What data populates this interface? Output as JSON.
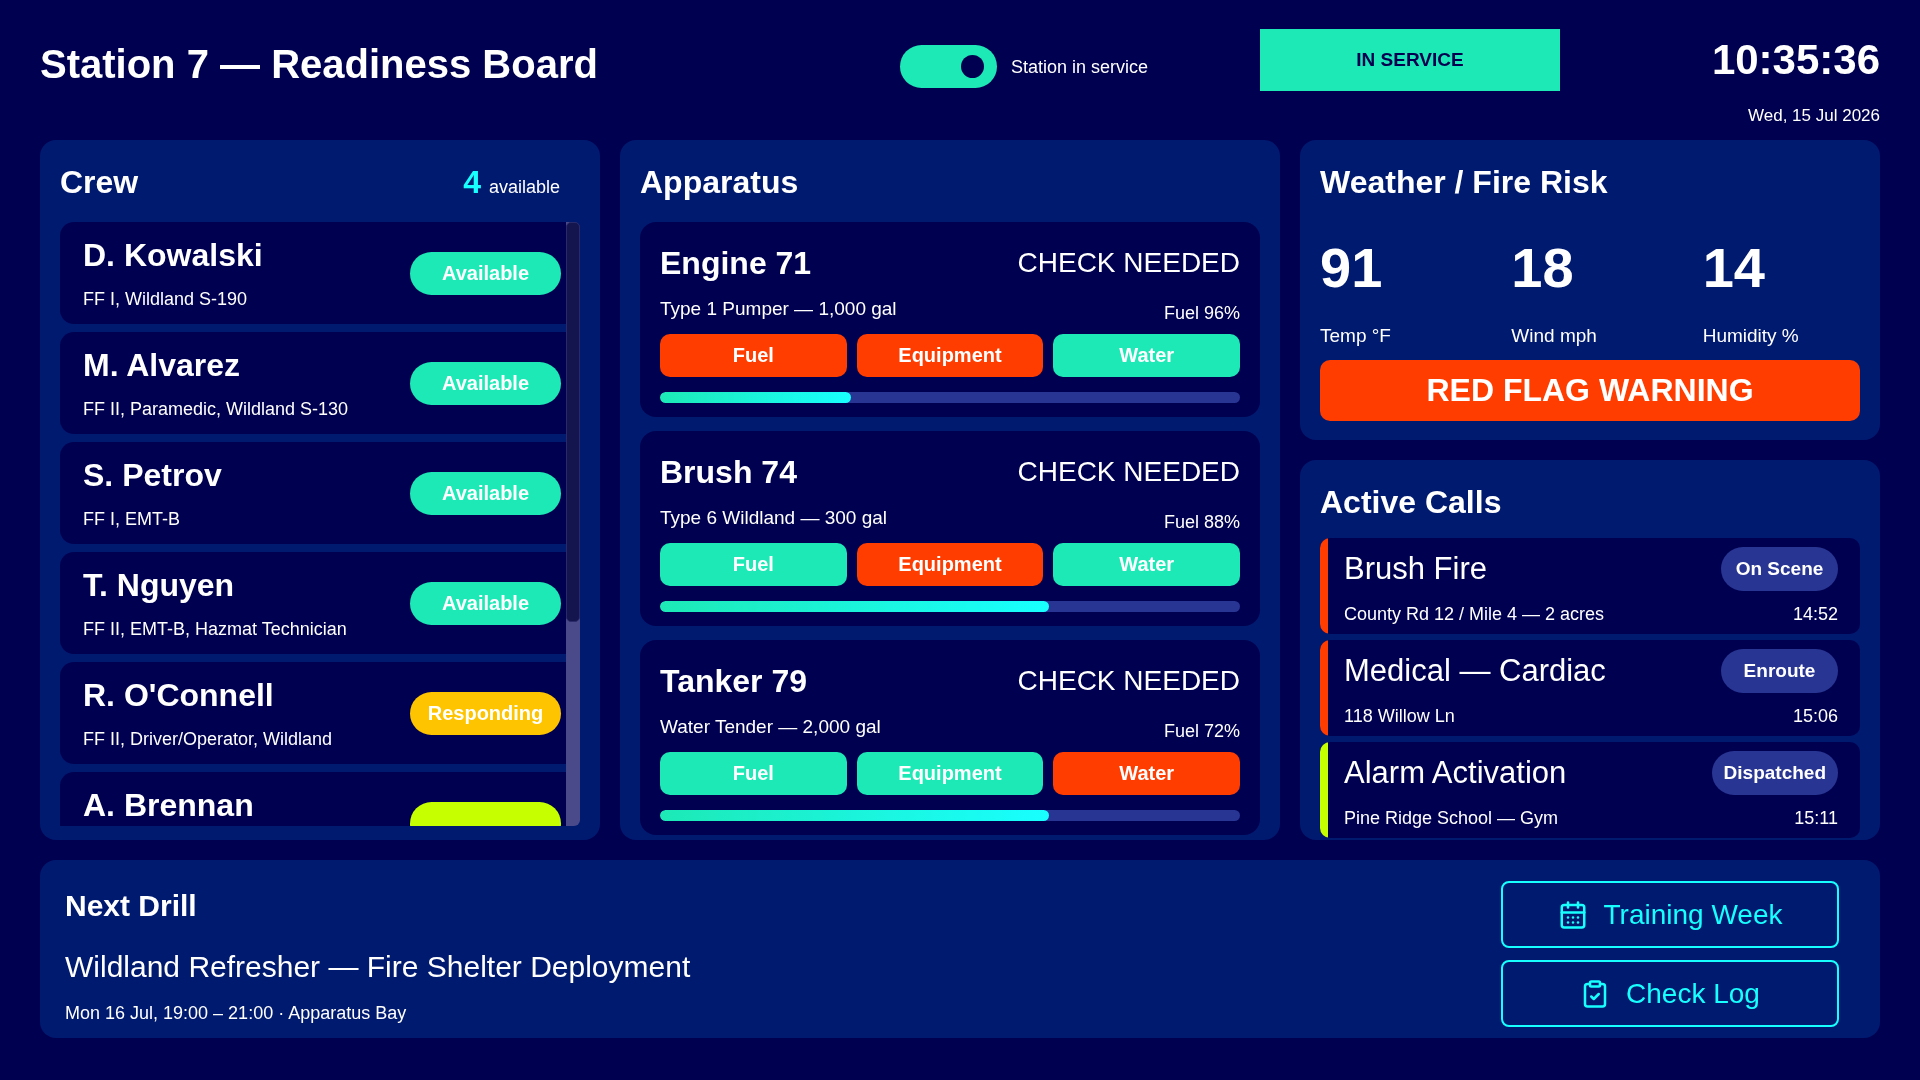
{
  "header": {
    "title": "Station 7 — Readiness Board",
    "service_toggle": {
      "label": "Station in service",
      "on": true
    },
    "status_banner": "IN SERVICE",
    "time": "10:35:36",
    "date": "Wed, 15 Jul 2026"
  },
  "crew": {
    "title": "Crew",
    "available_count": "4",
    "available_label": "available",
    "members": [
      {
        "name": "D. Kowalski",
        "qualifications": "FF I, Wildland S-190",
        "status": "Available",
        "color": "#1de9b6"
      },
      {
        "name": "M. Alvarez",
        "qualifications": "FF II, Paramedic, Wildland S-130",
        "status": "Available",
        "color": "#1de9b6"
      },
      {
        "name": "S. Petrov",
        "qualifications": "FF I, EMT-B",
        "status": "Available",
        "color": "#1de9b6"
      },
      {
        "name": "T. Nguyen",
        "qualifications": "FF II, EMT-B, Hazmat Technician",
        "status": "Available",
        "color": "#1de9b6"
      },
      {
        "name": "R. O'Connell",
        "qualifications": "FF II, Driver/Operator, Wildland",
        "status": "Responding",
        "color": "#ffc400"
      },
      {
        "name": "A. Brennan",
        "color": "#c6ff00"
      }
    ]
  },
  "apparatus": {
    "title": "Apparatus",
    "units": [
      {
        "name": "Engine 71",
        "status": "CHECK NEEDED",
        "description": "Type 1 Pumper — 1,000 gal",
        "fuel": "Fuel 96%",
        "checks": [
          {
            "label": "Fuel",
            "ok": false
          },
          {
            "label": "Equipment",
            "ok": false
          },
          {
            "label": "Water",
            "ok": true
          }
        ],
        "level": 0.33
      },
      {
        "name": "Brush 74",
        "status": "CHECK NEEDED",
        "description": "Type 6 Wildland — 300 gal",
        "fuel": "Fuel 88%",
        "checks": [
          {
            "label": "Fuel",
            "ok": true
          },
          {
            "label": "Equipment",
            "ok": false
          },
          {
            "label": "Water",
            "ok": true
          }
        ],
        "level": 0.67
      },
      {
        "name": "Tanker 79",
        "status": "CHECK NEEDED",
        "description": "Water Tender — 2,000 gal",
        "fuel": "Fuel 72%",
        "checks": [
          {
            "label": "Fuel",
            "ok": true
          },
          {
            "label": "Equipment",
            "ok": true
          },
          {
            "label": "Water",
            "ok": false
          }
        ],
        "level": 0.67
      }
    ]
  },
  "weather": {
    "title": "Weather / Fire Risk",
    "metrics": [
      {
        "value": "91",
        "label": "Temp °F"
      },
      {
        "value": "18",
        "label": "Wind mph"
      },
      {
        "value": "14",
        "label": "Humidity %"
      }
    ],
    "alert": "RED FLAG WARNING"
  },
  "active_calls": {
    "title": "Active Calls",
    "calls": [
      {
        "title": "Brush Fire",
        "location": "County Rd 12 / Mile 4 — 2 acres",
        "status": "On Scene",
        "time": "14:52",
        "color": "#ff3d00"
      },
      {
        "title": "Medical — Cardiac",
        "location": "118 Willow Ln",
        "status": "Enroute",
        "time": "15:06",
        "color": "#ff3d00"
      },
      {
        "title": "Alarm Activation",
        "location": "Pine Ridge School — Gym",
        "status": "Dispatched",
        "time": "15:11",
        "color": "#c6ff00"
      }
    ]
  },
  "next_drill": {
    "title": "Next Drill",
    "name": "Wildland Refresher — Fire Shelter Deployment",
    "schedule": "Mon 16 Jul, 19:00 – 21:00 · Apparatus Bay",
    "actions": [
      {
        "label": "Training Week",
        "kind": "calendar"
      },
      {
        "label": "Check Log",
        "kind": "clipboard"
      }
    ]
  }
}
